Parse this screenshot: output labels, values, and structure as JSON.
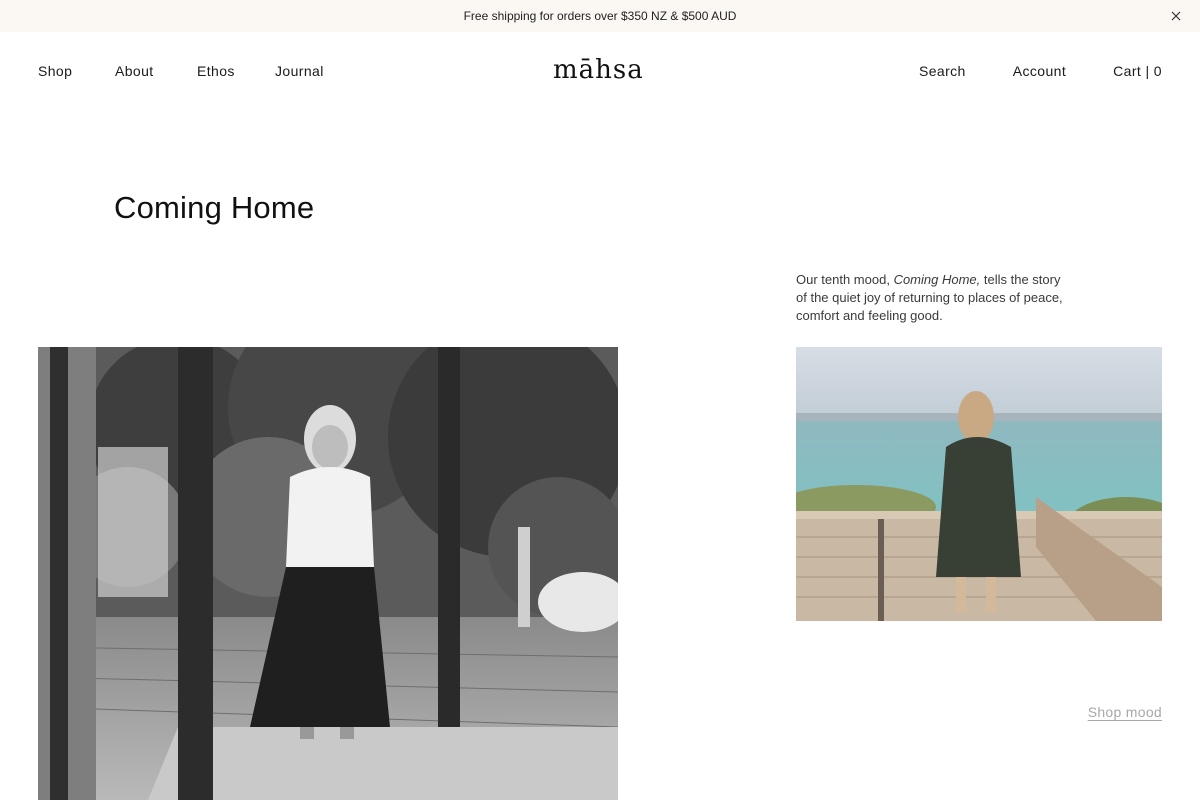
{
  "announcement": {
    "text": "Free shipping for orders over $350 NZ & $500 AUD"
  },
  "nav": {
    "left": [
      {
        "label": "Shop"
      },
      {
        "label": "About"
      },
      {
        "label": "Ethos"
      },
      {
        "label": "Journal"
      }
    ],
    "right": {
      "search": "Search",
      "account": "Account",
      "cart": "Cart | 0"
    }
  },
  "brand": {
    "logo": "māhsa"
  },
  "page": {
    "title": "Coming Home",
    "intro_before": "Our tenth mood, ",
    "intro_italic": "Coming Home,",
    "intro_after": " tells the story of the quiet joy of returning to places of peace, comfort and feeling good.",
    "cta": "Shop mood"
  },
  "colors": {
    "announce_bg": "#fbf7f3",
    "text": "#1a1a1a",
    "cta": "#a8a8a8"
  }
}
